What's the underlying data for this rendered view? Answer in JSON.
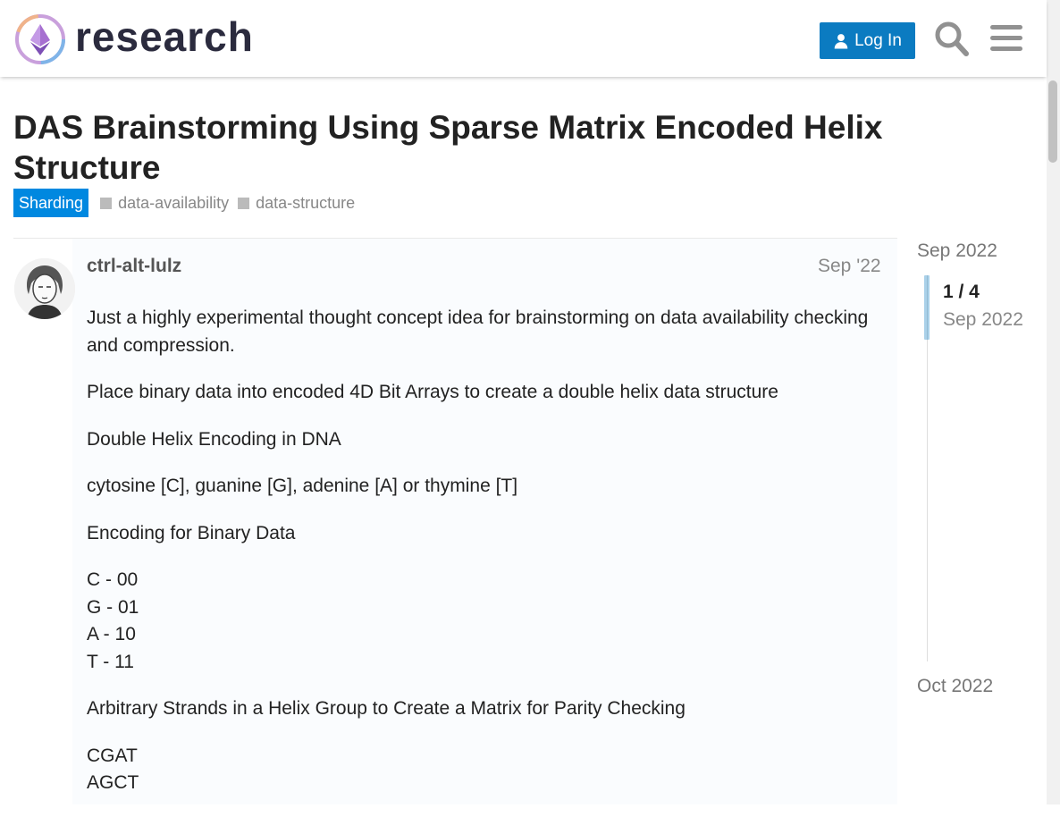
{
  "header": {
    "site_name": "research",
    "login_label": "Log In"
  },
  "topic": {
    "title": "DAS Brainstorming Using Sparse Matrix Encoded Helix Structure",
    "category": "Sharding",
    "tags": [
      "data-availability",
      "data-structure"
    ]
  },
  "post": {
    "username": "ctrl-alt-lulz",
    "date": "Sep '22",
    "paragraphs": [
      [
        "Just a highly experimental thought concept idea for brainstorming on data availability checking and compression."
      ],
      [
        "Place binary data into encoded 4D Bit Arrays to create a double helix data structure"
      ],
      [
        "Double Helix Encoding in DNA"
      ],
      [
        "cytosine [C], guanine [G], adenine [A] or thymine [T]"
      ],
      [
        "Encoding for Binary Data"
      ],
      [
        "C - 00",
        "G - 01",
        "A - 10",
        "T - 11"
      ],
      [
        "Arbitrary Strands in a Helix Group to Create a Matrix for Parity Checking"
      ],
      [
        "CGAT",
        "AGCT"
      ]
    ]
  },
  "timeline": {
    "start": "Sep 2022",
    "position": "1 / 4",
    "current_date": "Sep 2022",
    "end": "Oct 2022"
  },
  "colors": {
    "accent": "#0b7bc1",
    "category": "#0088e0"
  }
}
